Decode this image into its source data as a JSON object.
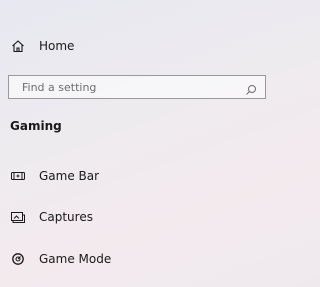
{
  "nav": {
    "home": {
      "label": "Home",
      "icon": "home-icon"
    }
  },
  "search": {
    "placeholder": "Find a setting",
    "value": "",
    "icon": "search-icon"
  },
  "section": {
    "title": "Gaming"
  },
  "menu": {
    "items": [
      {
        "label": "Game Bar",
        "icon": "game-bar-icon"
      },
      {
        "label": "Captures",
        "icon": "captures-icon"
      },
      {
        "label": "Game Mode",
        "icon": "game-mode-icon"
      }
    ]
  },
  "colors": {
    "text": "#1a1a1a",
    "border": "#9a9a9a",
    "placeholder": "#6d6d6d"
  }
}
